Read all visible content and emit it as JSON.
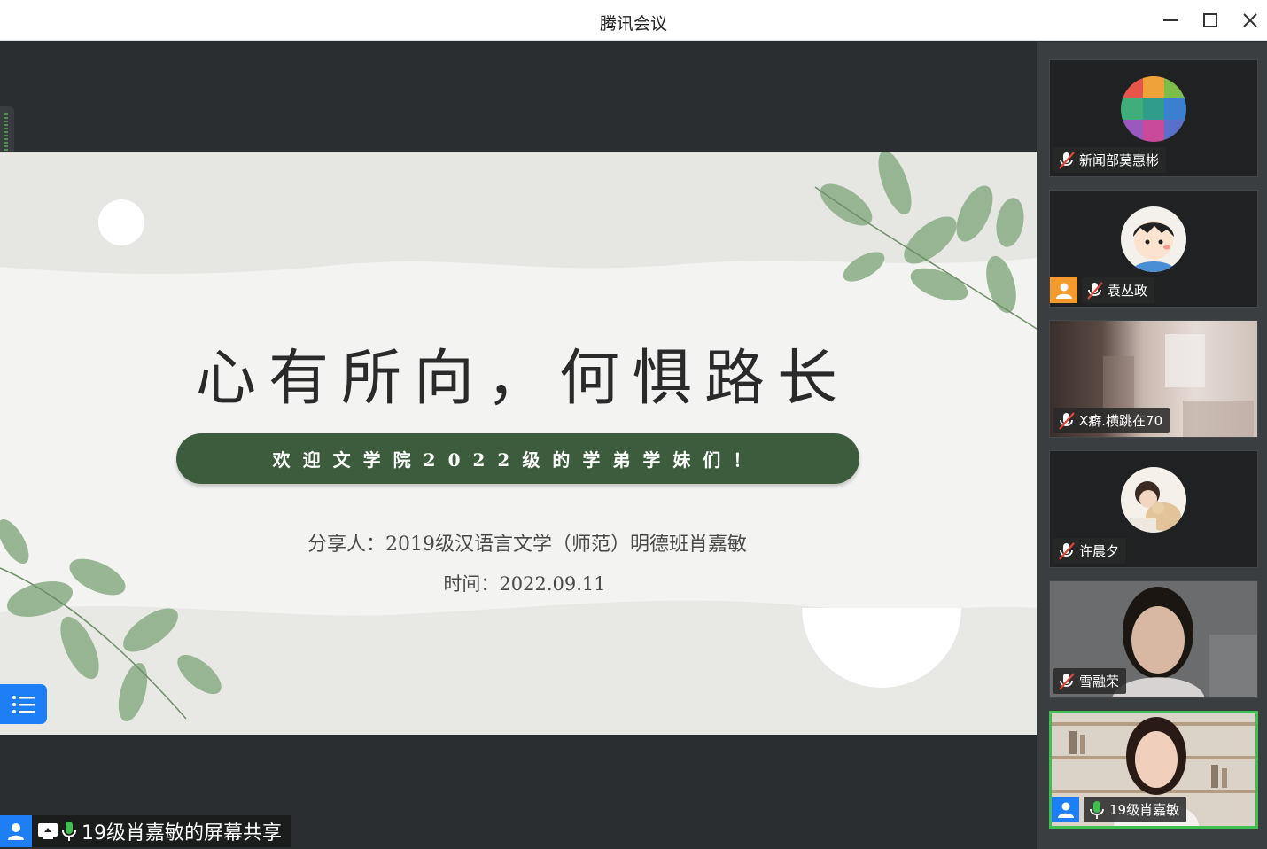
{
  "window": {
    "title": "腾讯会议"
  },
  "slide": {
    "title": "心有所向，何惧路长",
    "banner": "欢迎文学院2022级的学弟学妹们！",
    "presenter": "分享人：2019级汉语言文学（师范）明德班肖嘉敏",
    "date": "时间：2022.09.11"
  },
  "share_label": "19级肖嘉敏的屏幕共享",
  "participants": [
    {
      "name": "新闻部莫惠彬",
      "mic": "muted"
    },
    {
      "name": "袁丛政",
      "mic": "muted",
      "role": "host"
    },
    {
      "name": "X癖.横跳在70",
      "mic": "muted"
    },
    {
      "name": "许晨夕",
      "mic": "muted"
    },
    {
      "name": "雪融荣",
      "mic": "muted"
    },
    {
      "name": "19级肖嘉敏",
      "mic": "on",
      "role": "host",
      "active": true
    }
  ],
  "colors": {
    "accent": "#1e7ef5",
    "banner": "#3c5c3d",
    "active_border": "#3fbf4f",
    "muted": "#e0463b"
  },
  "icons": [
    "minimize-icon",
    "maximize-icon",
    "close-icon",
    "list-icon",
    "user-icon",
    "screen-share-icon",
    "mic-icon",
    "mic-muted-icon"
  ]
}
